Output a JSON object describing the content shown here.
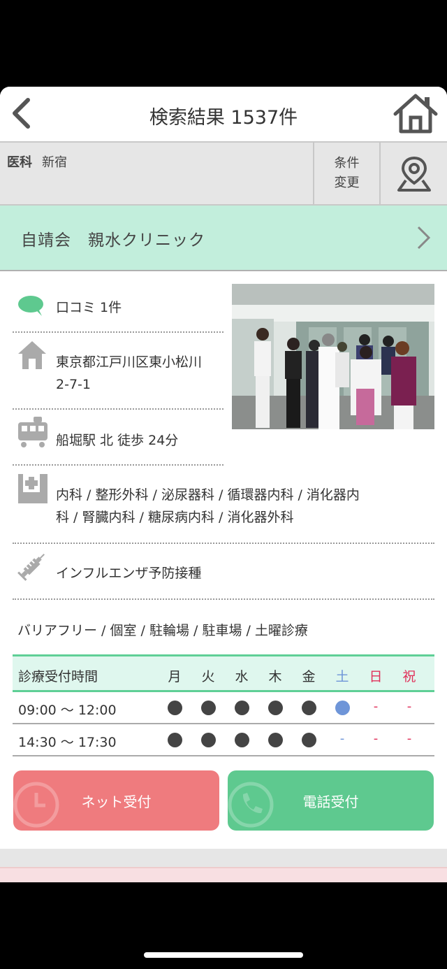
{
  "header": {
    "title": "検索結果 1537件"
  },
  "conditions": {
    "category": "医科",
    "area": "新宿",
    "change_line1": "条件",
    "change_line2": "変更"
  },
  "clinic": {
    "name": "自靖会　親水クリニック",
    "reviews": "口コミ 1件",
    "address_line1": "東京都江戸川区東小松川",
    "address_line2": "2-7-1",
    "station": "船堀駅 北 徒歩 24分",
    "departments_line1": "内科 / 整形外科 / 泌尿器科 / 循環器内科 / 消化器内",
    "departments_line2": "科 / 腎臓内科 / 糖尿病内科 / 消化器外科",
    "vaccination": "インフルエンザ予防接種",
    "features": "バリアフリー / 個室 / 駐輪場 / 駐車場 / 土曜診療"
  },
  "schedule": {
    "header_label": "診療受付時間",
    "days": [
      "月",
      "火",
      "水",
      "木",
      "金",
      "土",
      "日",
      "祝"
    ],
    "day_colors": [
      "#333333",
      "#333333",
      "#333333",
      "#333333",
      "#333333",
      "#6e95d8",
      "#e0305a",
      "#e0305a"
    ],
    "rows": [
      {
        "time": "09:00 〜 12:00",
        "marks": [
          "●",
          "●",
          "●",
          "●",
          "●",
          "●",
          "-",
          "-"
        ]
      },
      {
        "time": "14:30 〜 17:30",
        "marks": [
          "●",
          "●",
          "●",
          "●",
          "●",
          "-",
          "-",
          "-"
        ]
      }
    ]
  },
  "buttons": {
    "net": "ネット受付",
    "tel": "電話受付"
  },
  "colors": {
    "mint": "#c2eedc",
    "accent_green": "#5ec98f",
    "accent_red": "#ef7b7e",
    "saturday_blue": "#6e95d8"
  }
}
